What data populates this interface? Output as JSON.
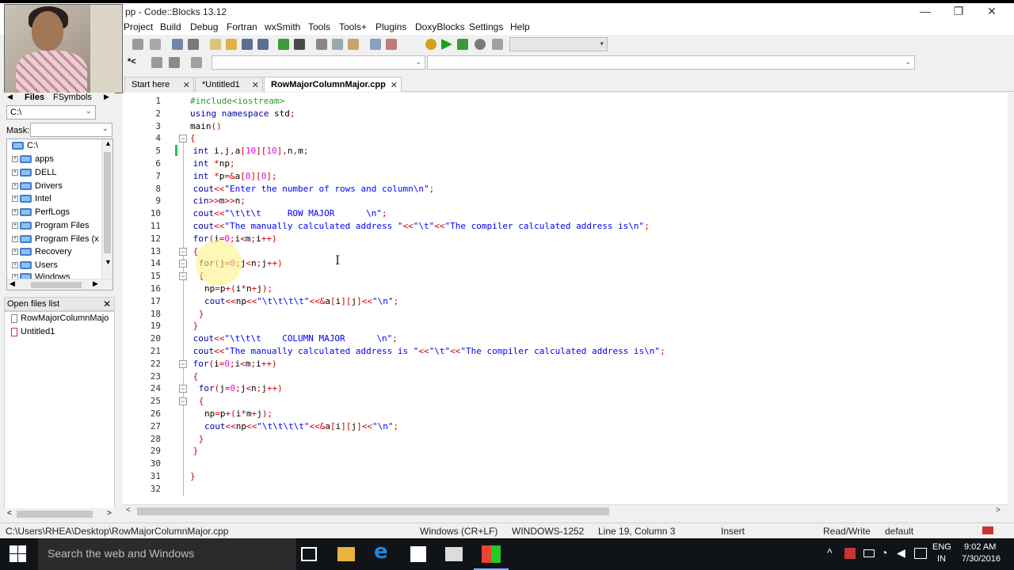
{
  "window": {
    "title": "pp - Code::Blocks 13.12",
    "minimize": "—",
    "maximize": "❐",
    "close": "✕"
  },
  "menu": [
    "Project",
    "Build",
    "Debug",
    "Fortran",
    "wxSmith",
    "Tools",
    "Tools+",
    "Plugins",
    "DoxyBlocks",
    "Settings",
    "Help"
  ],
  "side": {
    "tabs": [
      "Files",
      "FSymbols"
    ],
    "path": "C:\\",
    "mask_label": "Mask:",
    "tree": [
      "C:\\",
      "apps",
      "DELL",
      "Drivers",
      "Intel",
      "PerfLogs",
      "Program Files",
      "Program Files (x",
      "Recovery",
      "Users",
      "Windows"
    ],
    "open_files_title": "Open files list",
    "open_files": [
      "RowMajorColumnMajo",
      "Untitled1"
    ]
  },
  "tabs": [
    {
      "label": "Start here"
    },
    {
      "label": "*Untitled1"
    },
    {
      "label": "RowMajorColumnMajor.cpp"
    }
  ],
  "code_lines": [
    "#include<iostream>",
    "using namespace std;",
    "main()",
    "{",
    "int i,j,a[10][10],n,m;",
    "int *np;",
    "int *p=&a[0][0];",
    "cout<<\"Enter the number of rows and column\\n\";",
    "cin>>m>>n;",
    "cout<<\"\\t\\t\\t     ROW MAJOR      \\n\";",
    "cout<<\"The manually calculated address \"<<\"\\t\"<<\"The compiler calculated address is\\n\";",
    "for(i=0;i<m;i++)",
    "{",
    "for(j=0;j<n;j++)",
    "{",
    "np=p+(i*n+j);",
    "cout<<np<<\"\\t\\t\\t\\t\"<<&a[i][j]<<\"\\n\";",
    "}",
    "}",
    "cout<<\"\\t\\t\\t    COLUMN MAJOR      \\n\";",
    "cout<<\"The manually calculated address is \"<<\"\\t\"<<\"The compiler calculated address is\\n\";",
    "for(i=0;i<m;i++)",
    "{",
    "for(j=0;j<n;j++)",
    "{",
    "np=p+(i*m+j);",
    "cout<<np<<\"\\t\\t\\t\\t\"<<&a[i][j]<<\"\\n\";",
    "}",
    "}",
    "",
    "}",
    ""
  ],
  "status": {
    "path": "C:\\Users\\RHEA\\Desktop\\RowMajorColumnMajor.cpp",
    "eol": "Windows (CR+LF)",
    "encoding": "WINDOWS-1252",
    "position": "Line 19, Column 3",
    "mode": "Insert",
    "access": "Read/Write",
    "profile": "default"
  },
  "taskbar": {
    "search_placeholder": "Search the web and Windows",
    "lang": "ENG",
    "region": "IN",
    "time": "9:02 AM",
    "date": "7/30/2016"
  }
}
